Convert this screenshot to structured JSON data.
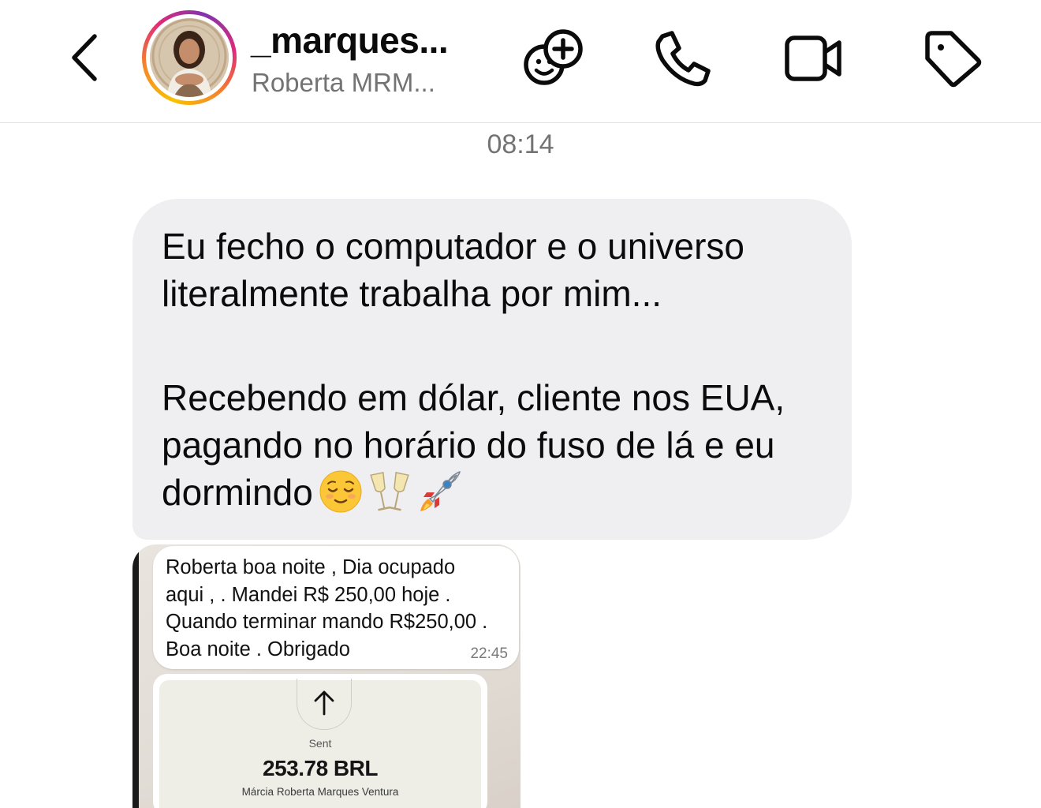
{
  "header": {
    "username": "_marques...",
    "subtitle": "Roberta MRM...",
    "icons": [
      "back-chevron-icon",
      "add-people-icon",
      "phone-icon",
      "video-camera-icon",
      "tag-icon"
    ]
  },
  "chat": {
    "timestamp": "08:14",
    "message": {
      "line1": "Eu fecho o computador e o universo",
      "line2": "literalmente trabalha por mim...",
      "line3": "Recebendo em dólar, cliente nos EUA,",
      "line4": "pagando no horário do fuso de lá e eu",
      "line5": "dormindo",
      "emojis": [
        "relieved-face-emoji",
        "champagne-glasses-emoji",
        "rocket-emoji"
      ]
    },
    "attachment": {
      "whatsapp_message": {
        "line1": "Roberta boa noite , Dia ocupado",
        "line2": "aqui , . Mandei R$ 250,00 hoje .",
        "line3": "Quando terminar mando R$250,00 .",
        "line4": "Boa noite . Obrigado",
        "time": "22:45"
      },
      "transfer": {
        "status": "Sent",
        "amount": "253.78 BRL",
        "recipient": "Márcia Roberta Marques Ventura"
      }
    }
  },
  "colors": {
    "bubble_bg": "#efeff1",
    "secondary_text": "#737373",
    "story_ring": [
      "#f9c200",
      "#f58529",
      "#dd2a7b",
      "#8134af"
    ]
  }
}
